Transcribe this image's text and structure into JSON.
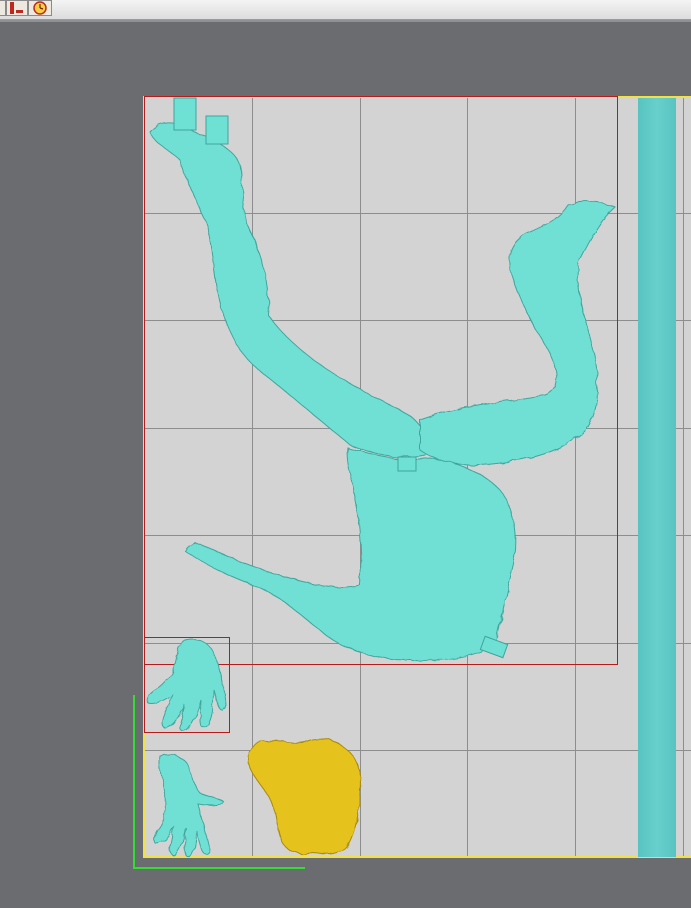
{
  "toolbar": {
    "icons": [
      "red-column-icon",
      "clock-icon"
    ]
  },
  "viewport": {
    "bed_border_color": "#f0e04a",
    "grid_color": "#8d8d8d",
    "model_color": "#6fe0d4",
    "selected_part_color": "#e6c21e",
    "selection_box_color": "#b51d1d",
    "axis_color": "#33dd33",
    "models": [
      "statue-body",
      "hand-left",
      "hand-right",
      "hair-part",
      "support-bar"
    ]
  }
}
